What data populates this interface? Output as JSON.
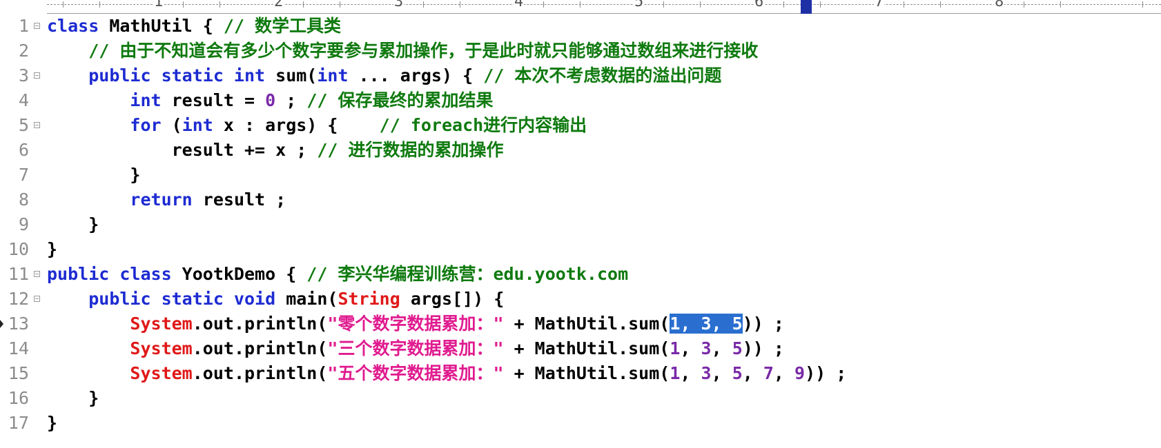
{
  "ruler": {
    "labels": [
      "1",
      "2",
      "3",
      "4",
      "5",
      "6",
      "7",
      "8"
    ]
  },
  "lines": [
    {
      "no": "1",
      "fold": true,
      "marker": false,
      "tokens": [
        {
          "t": "class",
          "c": "kw"
        },
        {
          "t": " MathUtil { ",
          "c": ""
        },
        {
          "t": "// 数学工具类",
          "c": "cm"
        }
      ]
    },
    {
      "no": "2",
      "fold": false,
      "marker": false,
      "tokens": [
        {
          "t": "    ",
          "c": ""
        },
        {
          "t": "// 由于不知道会有多少个数字要参与累加操作，于是此时就只能够通过数组来进行接收",
          "c": "cm"
        }
      ]
    },
    {
      "no": "3",
      "fold": true,
      "marker": false,
      "tokens": [
        {
          "t": "    ",
          "c": ""
        },
        {
          "t": "public static int",
          "c": "kw"
        },
        {
          "t": " sum(",
          "c": ""
        },
        {
          "t": "int",
          "c": "kw"
        },
        {
          "t": " ... args) { ",
          "c": ""
        },
        {
          "t": "// 本次不考虑数据的溢出问题",
          "c": "cm"
        }
      ]
    },
    {
      "no": "4",
      "fold": false,
      "marker": false,
      "tokens": [
        {
          "t": "        ",
          "c": ""
        },
        {
          "t": "int",
          "c": "kw"
        },
        {
          "t": " result = ",
          "c": ""
        },
        {
          "t": "0",
          "c": "nm"
        },
        {
          "t": " ; ",
          "c": ""
        },
        {
          "t": "// 保存最终的累加结果",
          "c": "cm"
        }
      ]
    },
    {
      "no": "5",
      "fold": true,
      "marker": false,
      "tokens": [
        {
          "t": "        ",
          "c": ""
        },
        {
          "t": "for",
          "c": "kw"
        },
        {
          "t": " (",
          "c": ""
        },
        {
          "t": "int",
          "c": "kw"
        },
        {
          "t": " x : args) {    ",
          "c": ""
        },
        {
          "t": "// foreach进行内容输出",
          "c": "cm"
        }
      ]
    },
    {
      "no": "6",
      "fold": false,
      "marker": false,
      "tokens": [
        {
          "t": "            result += x ; ",
          "c": ""
        },
        {
          "t": "// 进行数据的累加操作",
          "c": "cm"
        }
      ]
    },
    {
      "no": "7",
      "fold": false,
      "marker": false,
      "tokens": [
        {
          "t": "        }",
          "c": ""
        }
      ]
    },
    {
      "no": "8",
      "fold": false,
      "marker": false,
      "tokens": [
        {
          "t": "        ",
          "c": ""
        },
        {
          "t": "return",
          "c": "kw"
        },
        {
          "t": " result ;",
          "c": ""
        }
      ]
    },
    {
      "no": "9",
      "fold": false,
      "marker": false,
      "tokens": [
        {
          "t": "    }",
          "c": ""
        }
      ]
    },
    {
      "no": "10",
      "fold": false,
      "marker": false,
      "tokens": [
        {
          "t": "}",
          "c": ""
        }
      ]
    },
    {
      "no": "11",
      "fold": true,
      "marker": false,
      "tokens": [
        {
          "t": "public class",
          "c": "kw"
        },
        {
          "t": " YootkDemo { ",
          "c": ""
        },
        {
          "t": "// 李兴华编程训练营：edu.yootk.com",
          "c": "cm"
        }
      ]
    },
    {
      "no": "12",
      "fold": true,
      "marker": false,
      "tokens": [
        {
          "t": "    ",
          "c": ""
        },
        {
          "t": "public static void",
          "c": "kw"
        },
        {
          "t": " main(",
          "c": ""
        },
        {
          "t": "String",
          "c": "sys"
        },
        {
          "t": " args[]) {",
          "c": ""
        }
      ]
    },
    {
      "no": "13",
      "fold": false,
      "marker": true,
      "tokens": [
        {
          "t": "        ",
          "c": ""
        },
        {
          "t": "System",
          "c": "sys"
        },
        {
          "t": ".out.println(",
          "c": ""
        },
        {
          "t": "\"零个数字数据累加：\"",
          "c": "st"
        },
        {
          "t": " + MathUtil.sum(",
          "c": ""
        },
        {
          "t": "1, 3, 5",
          "c": "sel"
        },
        {
          "t": ")) ;",
          "c": ""
        }
      ]
    },
    {
      "no": "14",
      "fold": false,
      "marker": false,
      "tokens": [
        {
          "t": "        ",
          "c": ""
        },
        {
          "t": "System",
          "c": "sys"
        },
        {
          "t": ".out.println(",
          "c": ""
        },
        {
          "t": "\"三个数字数据累加：\"",
          "c": "st"
        },
        {
          "t": " + MathUtil.sum(",
          "c": ""
        },
        {
          "t": "1",
          "c": "nm"
        },
        {
          "t": ", ",
          "c": ""
        },
        {
          "t": "3",
          "c": "nm"
        },
        {
          "t": ", ",
          "c": ""
        },
        {
          "t": "5",
          "c": "nm"
        },
        {
          "t": ")) ;",
          "c": ""
        }
      ]
    },
    {
      "no": "15",
      "fold": false,
      "marker": false,
      "tokens": [
        {
          "t": "        ",
          "c": ""
        },
        {
          "t": "System",
          "c": "sys"
        },
        {
          "t": ".out.println(",
          "c": ""
        },
        {
          "t": "\"五个数字数据累加：\"",
          "c": "st"
        },
        {
          "t": " + MathUtil.sum(",
          "c": ""
        },
        {
          "t": "1",
          "c": "nm"
        },
        {
          "t": ", ",
          "c": ""
        },
        {
          "t": "3",
          "c": "nm"
        },
        {
          "t": ", ",
          "c": ""
        },
        {
          "t": "5",
          "c": "nm"
        },
        {
          "t": ", ",
          "c": ""
        },
        {
          "t": "7",
          "c": "nm"
        },
        {
          "t": ", ",
          "c": ""
        },
        {
          "t": "9",
          "c": "nm"
        },
        {
          "t": ")) ;",
          "c": ""
        }
      ]
    },
    {
      "no": "16",
      "fold": false,
      "marker": false,
      "tokens": [
        {
          "t": "    }",
          "c": ""
        }
      ]
    },
    {
      "no": "17",
      "fold": false,
      "marker": false,
      "tokens": [
        {
          "t": "}",
          "c": ""
        }
      ]
    }
  ]
}
